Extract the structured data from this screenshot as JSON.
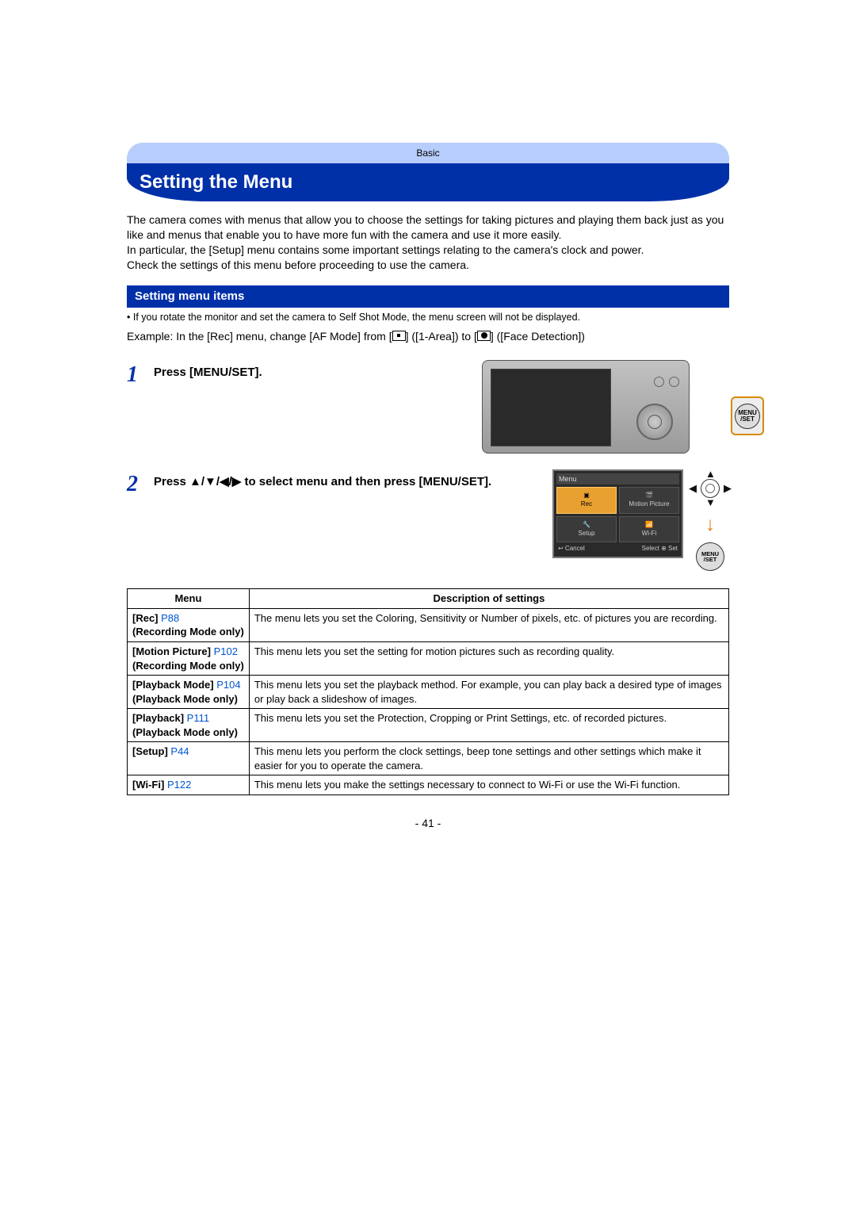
{
  "breadcrumb": "Basic",
  "title": "Setting the Menu",
  "intro_p1": "The camera comes with menus that allow you to choose the settings for taking pictures and playing them back just as you like and menus that enable you to have more fun with the camera and use it more easily.",
  "intro_p2": "In particular, the [Setup] menu contains some important settings relating to the camera's clock and power.",
  "intro_p3": "Check the settings of this menu before proceeding to use the camera.",
  "section_header": "Setting menu items",
  "bullet_note": "• If you rotate the monitor and set the camera to Self Shot Mode, the menu screen will not be displayed.",
  "example_prefix": "Example: In the [Rec] menu, change [AF Mode] from [",
  "example_mid1": "] ([1-Area]) to [",
  "example_suffix": "] ([Face Detection])",
  "steps": {
    "s1": {
      "num": "1",
      "text": "Press [MENU/SET]."
    },
    "s2": {
      "num": "2",
      "text": "Press ▲/▼/◀/▶ to select menu and then press [MENU/SET]."
    }
  },
  "menuset_label1": "MENU",
  "menuset_label2": "/SET",
  "menu_screen": {
    "title": "Menu",
    "tiles": {
      "rec": "Rec",
      "motion": "Motion Picture",
      "setup": "Setup",
      "wifi": "Wi-Fi"
    },
    "footer_cancel": "↩ Cancel",
    "footer_select": "Select ⊕ Set"
  },
  "table": {
    "head_menu": "Menu",
    "head_desc": "Description of settings",
    "rows": {
      "r1": {
        "name": "[Rec]",
        "page": "P88",
        "sub": "(Recording Mode only)",
        "desc": "The menu lets you set the Coloring, Sensitivity or Number of pixels, etc. of pictures you are recording."
      },
      "r2": {
        "name": "[Motion Picture]",
        "page": "P102",
        "sub": "(Recording Mode only)",
        "desc": "This menu lets you set the setting for motion pictures such as recording quality."
      },
      "r3": {
        "name": "[Playback Mode]",
        "page": "P104",
        "sub": "(Playback Mode only)",
        "desc": "This menu lets you set the playback method. For example, you can play back a desired type of images or play back a slideshow of images."
      },
      "r4": {
        "name": "[Playback]",
        "page": "P111",
        "sub": "(Playback Mode only)",
        "desc": "This menu lets you set the Protection, Cropping or Print Settings, etc. of recorded pictures."
      },
      "r5": {
        "name": "[Setup]",
        "page": "P44",
        "sub": "",
        "desc": "This menu lets you perform the clock settings, beep tone settings and other settings which make it easier for you to operate the camera."
      },
      "r6": {
        "name": "[Wi-Fi]",
        "page": "P122",
        "sub": "",
        "desc": "This menu lets you make the settings necessary to connect to Wi-Fi or use the Wi-Fi function."
      }
    }
  },
  "page_number": "- 41 -"
}
